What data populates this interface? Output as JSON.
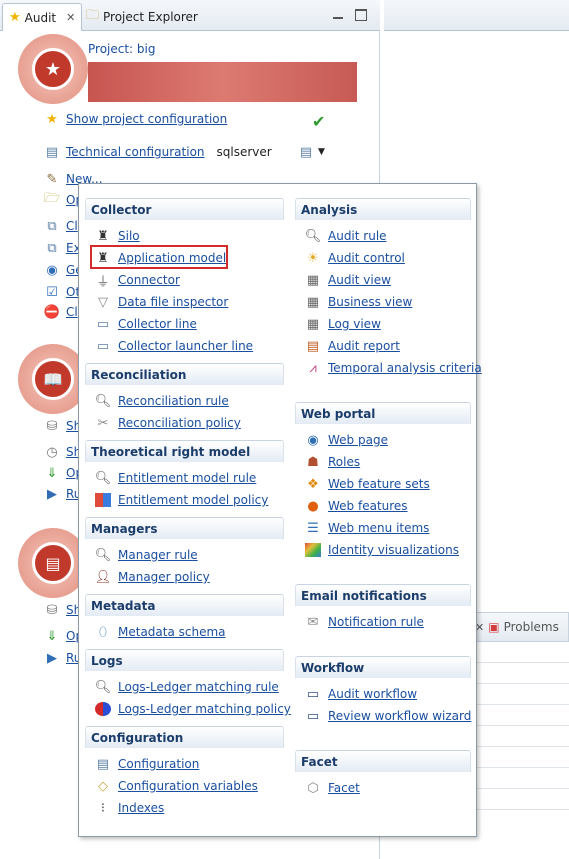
{
  "tabs": {
    "audit": "Audit",
    "project_explorer": "Project Explorer"
  },
  "audit": {
    "project_label": "Project: big",
    "show_project_configuration": "Show project configuration",
    "technical_configuration": "Technical configuration",
    "technical_value": "sqlserver",
    "new_link": "New...",
    "truncated_links": [
      "Op",
      "Cl",
      "Ex",
      "Ge",
      "Ot",
      "Cl"
    ],
    "section2_links": [
      "Sh",
      "Sh",
      "Op",
      "Ru"
    ],
    "section3_links": [
      "Sh",
      "Op",
      "Ru"
    ]
  },
  "bottom_bar": {
    "problems_label": "Problems"
  },
  "menu": {
    "collector": {
      "header": "Collector",
      "items": [
        "Silo",
        "Application model",
        "Connector",
        "Data file inspector",
        "Collector line",
        "Collector launcher line"
      ]
    },
    "reconciliation": {
      "header": "Reconciliation",
      "items": [
        "Reconciliation rule",
        "Reconciliation policy"
      ]
    },
    "theoretical": {
      "header": "Theoretical right model",
      "items": [
        "Entitlement model rule",
        "Entitlement model policy"
      ]
    },
    "managers": {
      "header": "Managers",
      "items": [
        "Manager rule",
        "Manager policy"
      ]
    },
    "metadata": {
      "header": "Metadata",
      "items": [
        "Metadata schema"
      ]
    },
    "logs": {
      "header": "Logs",
      "items": [
        "Logs-Ledger matching rule",
        "Logs-Ledger matching policy"
      ]
    },
    "configuration": {
      "header": "Configuration",
      "items": [
        "Configuration",
        "Configuration variables",
        "Indexes"
      ]
    },
    "analysis": {
      "header": "Analysis",
      "items": [
        "Audit rule",
        "Audit control",
        "Audit view",
        "Business view",
        "Log view",
        "Audit report",
        "Temporal analysis criteria"
      ]
    },
    "web_portal": {
      "header": "Web portal",
      "items": [
        "Web page",
        "Roles",
        "Web feature sets",
        "Web features",
        "Web menu items",
        "Identity visualizations"
      ]
    },
    "email": {
      "header": "Email notifications",
      "items": [
        "Notification rule"
      ]
    },
    "workflow": {
      "header": "Workflow",
      "items": [
        "Audit workflow",
        "Review workflow wizard"
      ]
    },
    "facet": {
      "header": "Facet",
      "items": [
        "Facet"
      ]
    }
  },
  "colors": {
    "link": "#1a4fa0",
    "header_text": "#1c3d6b",
    "highlight": "#d42a2a",
    "badge": "#c0392b"
  }
}
